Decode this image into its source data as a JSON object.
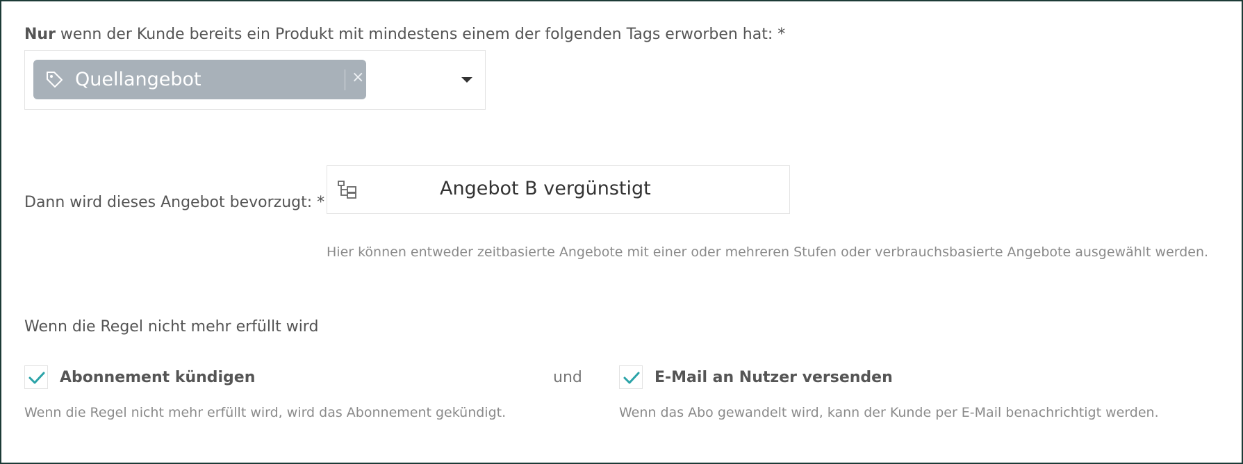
{
  "tags_condition": {
    "label_bold": "Nur",
    "label_rest": " wenn der Kunde bereits ein Produkt mit mindestens einem der folgenden Tags erworben hat:",
    "required_marker": " *",
    "selected_tag": "Quellangebot",
    "remove_glyph": "×"
  },
  "preferred_offer": {
    "label": "Dann wird dieses Angebot bevorzugt:",
    "required_marker": " *",
    "value": "Angebot B vergünstigt",
    "hint": "Hier können entweder zeitbasierte Angebote mit einer oder mehreren Stufen oder verbrauchsbasierte Angebote ausgewählt werden."
  },
  "rule_not_met": {
    "title": "Wenn die Regel nicht mehr erfüllt wird",
    "conjunction": "und",
    "options": [
      {
        "label": "Abonnement kündigen",
        "checked": true,
        "description": "Wenn die Regel nicht mehr erfüllt wird, wird das Abonnement gekündigt."
      },
      {
        "label": "E-Mail an Nutzer versenden",
        "checked": true,
        "description": "Wenn das Abo gewandelt wird, kann der Kunde per E-Mail benachrichtigt werden."
      }
    ]
  },
  "icons": {
    "tag": "tag-icon",
    "dropdown": "chevron-down-icon",
    "offer": "tree-structure-icon",
    "check": "checkmark-icon"
  },
  "colors": {
    "chip_background": "#a8b1b9",
    "check_accent": "#2aa3a8",
    "frame_border": "#1c3b37"
  }
}
